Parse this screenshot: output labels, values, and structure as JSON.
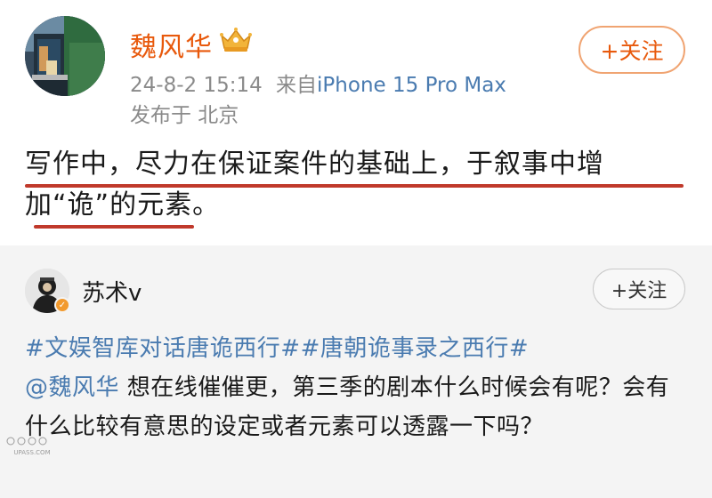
{
  "post": {
    "author_name": "魏风华",
    "follow_label": "+关注",
    "timestamp": "24-8-2 15:14",
    "source_prefix": "来自",
    "device": "iPhone 15 Pro Max",
    "location": "发布于 北京",
    "text": "写作中，尽力在保证案件的基础上，于叙事中增加“诡”的元素。",
    "avatar_icon": "painting-avatar-icon",
    "badge_icon": "crown-badge-icon"
  },
  "comment": {
    "author_name": "苏术v",
    "follow_label": "+关注",
    "hashtags": "#文娱智库对话唐诡西行##唐朝诡事录之西行#",
    "mention": "@魏风华",
    "text": " 想在线催催更，第三季的剧本什么时候会有呢？会有什么比较有意思的设定或者元素可以透露一下吗？",
    "avatar_icon": "user-avatar-icon",
    "verify_icon": "verified-badge-icon"
  },
  "watermark": "UPASS.COM",
  "colors": {
    "accent": "#e8590c",
    "link": "#4a7bb0",
    "underline": "#c0392b",
    "card_bg": "#f4f4f4"
  }
}
